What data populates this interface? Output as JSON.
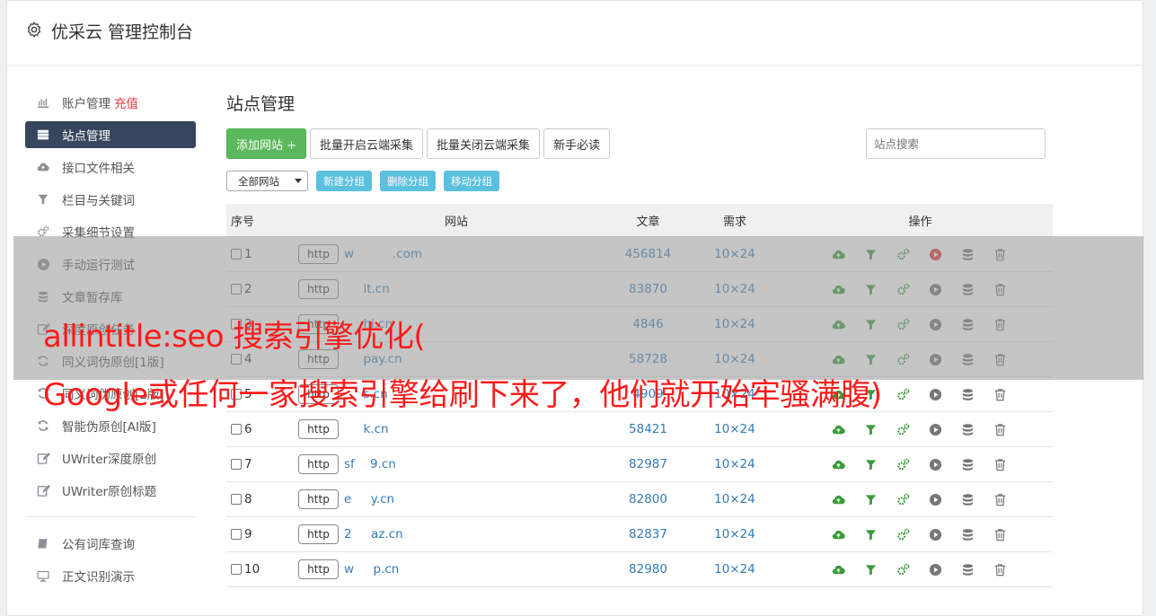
{
  "header": {
    "title": "优采云 管理控制台",
    "icon": "gear-icon"
  },
  "sidebar": {
    "items": [
      {
        "label": "账户管理",
        "badge": "充值",
        "icon": "bar-chart-icon"
      },
      {
        "label": "站点管理",
        "icon": "server-icon",
        "active": true
      },
      {
        "label": "接口文件相关",
        "icon": "cloud-upload-icon"
      },
      {
        "label": "栏目与关键词",
        "icon": "filter-icon"
      },
      {
        "label": "采集细节设置",
        "icon": "cogs-icon"
      },
      {
        "label": "手动运行测试",
        "icon": "play-icon"
      },
      {
        "label": "文章暂存库",
        "icon": "database-icon"
      },
      {
        "label": "深度原创任务",
        "icon": "edit-icon"
      },
      {
        "label": "同义词伪原创[1版]",
        "icon": "refresh-icon"
      },
      {
        "label": "同义词伪原创[2版]",
        "icon": "refresh-icon"
      },
      {
        "label": "智能伪原创[AI版]",
        "icon": "refresh-icon"
      },
      {
        "label": "UWriter深度原创",
        "icon": "edit-icon"
      },
      {
        "label": "UWriter原创标题",
        "icon": "edit-icon"
      }
    ],
    "items2": [
      {
        "label": "公有词库查询",
        "icon": "book-icon"
      },
      {
        "label": "正文识别演示",
        "icon": "monitor-icon"
      }
    ]
  },
  "main": {
    "title": "站点管理",
    "toolbar": {
      "add": "添加网站 +",
      "batch_open": "批量开启云端采集",
      "batch_close": "批量关闭云端采集",
      "guide": "新手必读"
    },
    "search_placeholder": "站点搜索",
    "group_select": "全部网站",
    "group_buttons": {
      "new": "新建分组",
      "delete": "删除分组",
      "move": "移动分组"
    },
    "table": {
      "headers": {
        "no": "序号",
        "site": "网站",
        "articles": "文章",
        "demand": "需求",
        "ops": "操作"
      },
      "rows": [
        {
          "no": "1",
          "proto": "http",
          "domain": "w          .com",
          "articles": "456814",
          "demand": "10×24",
          "running": true
        },
        {
          "no": "2",
          "proto": "http",
          "domain": "     lt.cn",
          "articles": "83870",
          "demand": "10×24",
          "running": false
        },
        {
          "no": "3",
          "proto": "http",
          "domain": "     hi.cn",
          "articles": "4846",
          "demand": "10×24",
          "running": false
        },
        {
          "no": "4",
          "proto": "http",
          "domain": "     pay.cn",
          "articles": "58728",
          "demand": "10×24",
          "running": false
        },
        {
          "no": "5",
          "proto": "http",
          "domain": "     s.cn",
          "articles": "4909",
          "demand": "10×24",
          "running": false
        },
        {
          "no": "6",
          "proto": "http",
          "domain": "     k.cn",
          "articles": "58421",
          "demand": "10×24",
          "running": false
        },
        {
          "no": "7",
          "proto": "http",
          "domain": "sf    9.cn",
          "articles": "82987",
          "demand": "10×24",
          "running": false
        },
        {
          "no": "8",
          "proto": "http",
          "domain": "e     y.cn",
          "articles": "82800",
          "demand": "10×24",
          "running": false
        },
        {
          "no": "9",
          "proto": "http",
          "domain": "2     az.cn",
          "articles": "82837",
          "demand": "10×24",
          "running": false
        },
        {
          "no": "10",
          "proto": "http",
          "domain": "w     p.cn",
          "articles": "82980",
          "demand": "10×24",
          "running": false
        }
      ]
    }
  },
  "overlay": {
    "line1": "allintitle:seo 搜索引擎优化(",
    "line2": "Google或任何一家搜索引擎给刷下来了，他们就开始牢骚满腹)"
  },
  "colors": {
    "accent": "#37465d",
    "green": "#5cb85c",
    "info": "#5bc0de",
    "link": "#337ab7",
    "overlay_text": "#ff1a1a"
  }
}
